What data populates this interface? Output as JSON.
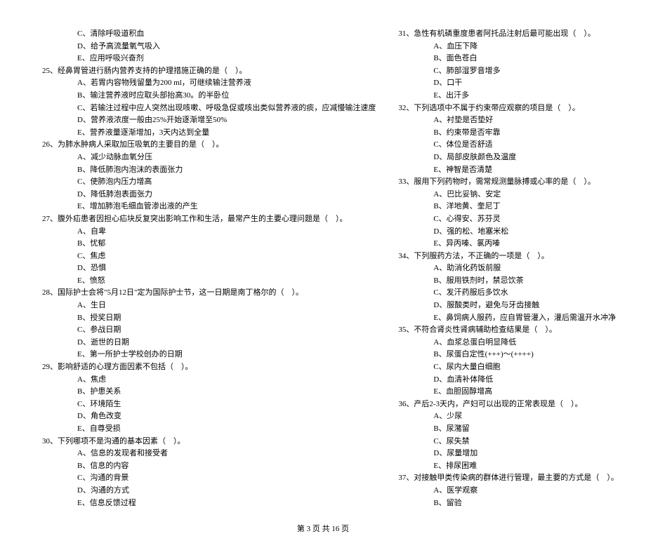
{
  "leftCol": {
    "pre_options": [
      "C、清除呼吸道积血",
      "D、给予高流量氧气吸入",
      "E、应用呼吸兴奋剂"
    ],
    "questions": [
      {
        "num": "25",
        "text": "经鼻胃管进行肠内营养支持的护理措施正确的是（    ）。",
        "options": [
          "A、若胃内容物残留量为200 ml，可继续输注营养液",
          "B、输注营养液时应取头部抬高30。的半卧位",
          "C、若输注过程中应人突然出现咳嗽、呼吸急促或咳出类似营养液的痰，应减慢输注速度",
          "D、营养液浓度一般由25%开始逐渐增至50%",
          "E、营养液量逐渐增加，3天内达到全量"
        ]
      },
      {
        "num": "26",
        "text": "为肺水肿病人采取加压吸氧的主要目的是（    ）。",
        "options": [
          "A、减少动脉血氧分压",
          "B、降低肺泡内泡沫的表面张力",
          "C、使肺泡内压力增高",
          "D、降低肺泡表面张力",
          "E、增加肺泡毛细血管渗出液的产生"
        ]
      },
      {
        "num": "27",
        "text": "腹外疝患者因担心疝块反复突出影响工作和生活，最常产生的主要心理问题是（    ）。",
        "options": [
          "A、自卑",
          "B、忧郁",
          "C、焦虑",
          "D、恐惧",
          "E、愤怒"
        ]
      },
      {
        "num": "28",
        "text": "国际护士会将\"5月12日\"定为国际护士节，这一日期是南丁格尔的（    ）。",
        "options": [
          "A、生日",
          "B、授奖日期",
          "C、参战日期",
          "D、逝世的日期",
          "E、第一所护士学校创办的日期"
        ]
      },
      {
        "num": "29",
        "text": "影响舒适的心理方面因素不包括（    ）。",
        "options": [
          "A、焦虑",
          "B、护患关系",
          "C、环境陌生",
          "D、角色改变",
          "E、自尊受损"
        ]
      },
      {
        "num": "30",
        "text": "下列哪项不是沟通的基本因素（    ）。",
        "options": [
          "A、信息的发现者和接受者",
          "B、信息的内容",
          "C、沟通的背景",
          "D、沟通的方式",
          "E、信息反馈过程"
        ]
      }
    ]
  },
  "rightCol": {
    "questions": [
      {
        "num": "31",
        "text": "急性有机磷重度患者阿托品注射后最可能出现（    ）。",
        "options": [
          "A、血压下降",
          "B、面色苍白",
          "C、肺部湿罗音增多",
          "D、口干",
          "E、出汗多"
        ]
      },
      {
        "num": "32",
        "text": "下列选项中不属于约束带应观察的项目是（    ）。",
        "options": [
          "A、衬垫是否垫好",
          "B、约束带是否牢靠",
          "C、体位是否舒适",
          "D、局部皮肤颜色及温度",
          "E、神智是否清楚"
        ]
      },
      {
        "num": "33",
        "text": "服用下列药物时，需常规测量脉搏或心率的是（    ）。",
        "options": [
          "A、巴比妥钠、安定",
          "B、洋地黄、奎尼丁",
          "C、心得安、苏芬灵",
          "D、强的松、地塞米松",
          "E、异丙嗪、氯丙嗪"
        ]
      },
      {
        "num": "34",
        "text": "下列服药方法，不正确的一项是（    ）。",
        "options": [
          "A、助消化药饭前服",
          "B、服用铁剂时，禁忌饮茶",
          "C、发汗药服后多饮水",
          "D、服酸类时，避免与牙齿接触",
          "E、鼻饲病人服药，应自胃管灌入，灌后需温开水冲净"
        ]
      },
      {
        "num": "35",
        "text": "不符合肾炎性肾病辅助检查结果是（    ）。",
        "options": [
          "A、血浆总蛋白明显降低",
          "B、尿蛋白定性(+++)～(++++)",
          "C、尿内大量白细胞",
          "D、血清补体降低",
          "E、血胆固醇增高"
        ]
      },
      {
        "num": "36",
        "text": "产后2-3天内，产妇可以出现的正常表现是（    ）。",
        "options": [
          "A、少尿",
          "B、尿潴留",
          "C、尿失禁",
          "D、尿量增加",
          "E、排尿困难"
        ]
      },
      {
        "num": "37",
        "text": "对接触甲类传染病的群体进行管理，最主要的方式是（    ）。",
        "options": [
          "A、医学观察",
          "B、留验"
        ]
      }
    ]
  },
  "footer": "第 3 页 共 16 页"
}
